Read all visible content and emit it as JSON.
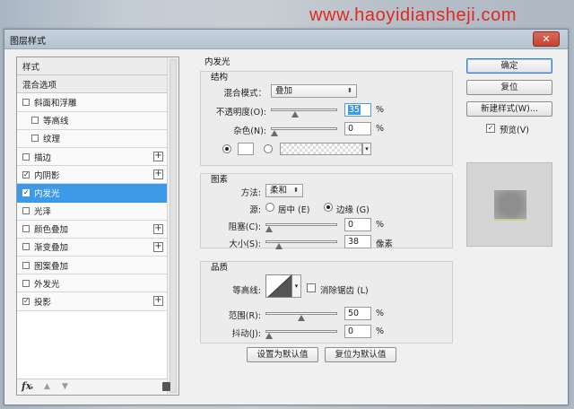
{
  "watermark": "www.haoyidiansheji.com",
  "window": {
    "title": "图层样式",
    "close_icon": "close-icon"
  },
  "styles_list": {
    "items": [
      {
        "label": "样式",
        "kind": "header"
      },
      {
        "label": "混合选项",
        "kind": "header"
      },
      {
        "label": "斜面和浮雕",
        "checked": false
      },
      {
        "label": "等高线",
        "checked": false,
        "indent": true
      },
      {
        "label": "纹理",
        "checked": false,
        "indent": true
      },
      {
        "label": "描边",
        "checked": false,
        "plus": true
      },
      {
        "label": "内阴影",
        "checked": true,
        "plus": true
      },
      {
        "label": "内发光",
        "checked": true,
        "selected": true
      },
      {
        "label": "光泽",
        "checked": false
      },
      {
        "label": "颜色叠加",
        "checked": false,
        "plus": true
      },
      {
        "label": "渐变叠加",
        "checked": false,
        "plus": true
      },
      {
        "label": "图案叠加",
        "checked": false
      },
      {
        "label": "外发光",
        "checked": false
      },
      {
        "label": "投影",
        "checked": true,
        "plus": true
      }
    ],
    "footer": {
      "fx": "fx",
      "up_icon": "arrow-up-icon",
      "down_icon": "arrow-down-icon",
      "trash_icon": "trash-icon"
    }
  },
  "inner_glow": {
    "title": "内发光",
    "structure": {
      "title": "结构",
      "blend_mode_label": "混合模式：",
      "blend_mode_value": "叠加",
      "opacity_label": "不透明度(O):",
      "opacity_value": "35",
      "opacity_level": 35,
      "noise_label": "杂色(N):",
      "noise_value": "0",
      "noise_level": 0,
      "unit": "%"
    },
    "elements": {
      "title": "图素",
      "technique_label": "方法:",
      "technique_value": "柔和",
      "source_label": "源:",
      "source_center": "居中 (E)",
      "source_edge": "边缘 (G)",
      "choke_label": "阻塞(C):",
      "choke_value": "0",
      "choke_level": 0,
      "size_label": "大小(S):",
      "size_value": "38",
      "size_level": 15,
      "size_unit": "像素",
      "unit": "%"
    },
    "quality": {
      "title": "品质",
      "contour_label": "等高线:",
      "antialias_label": "消除锯齿 (L)",
      "range_label": "范围(R):",
      "range_value": "50",
      "range_level": 50,
      "jitter_label": "抖动(J):",
      "jitter_value": "0",
      "jitter_level": 0,
      "unit": "%"
    },
    "make_default": "设置为默认值",
    "reset_default": "复位为默认值"
  },
  "buttons": {
    "ok": "确定",
    "reset": "复位",
    "new_style": "新建样式(W)...",
    "preview": "预览(V)"
  }
}
